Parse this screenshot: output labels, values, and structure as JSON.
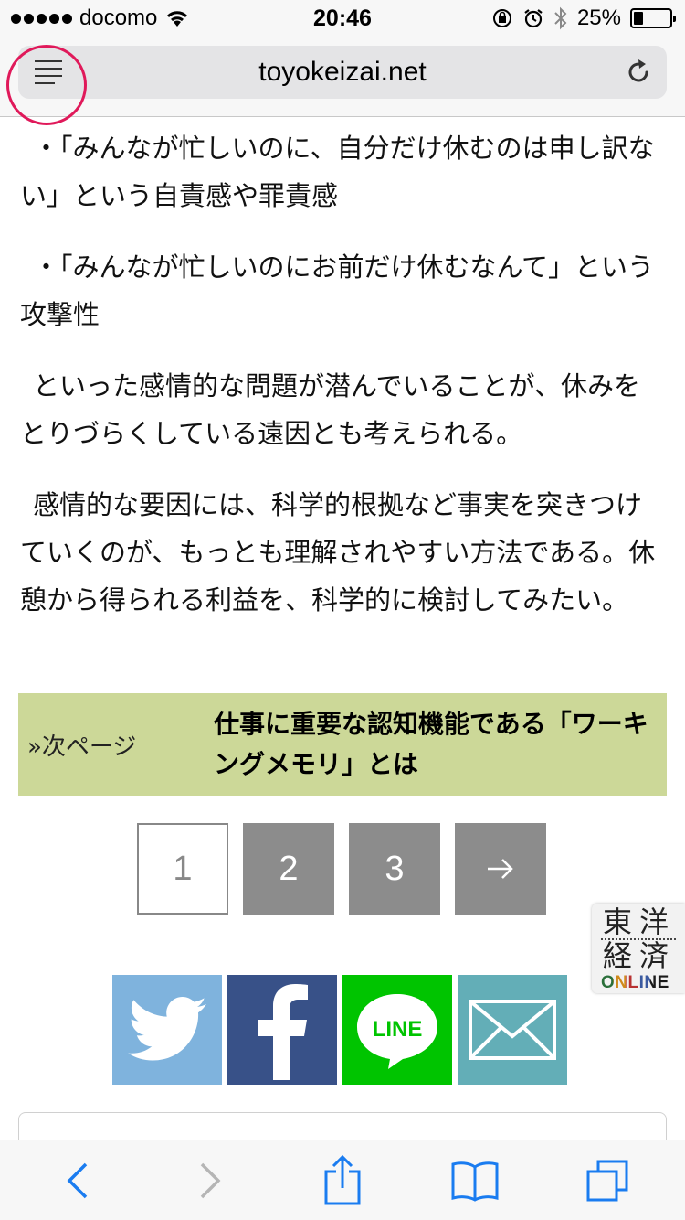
{
  "status_bar": {
    "carrier": "docomo",
    "time": "20:46",
    "battery_percent_text": "25%",
    "battery_level": 0.25
  },
  "browser": {
    "url": "toyokeizai.net"
  },
  "article": {
    "paragraphs": [
      "・「みんなが忙しいのに、自分だけ休むのは申し訳ない」という自責感や罪責感",
      "・「みんなが忙しいのにお前だけ休むなんて」という攻撃性",
      "といった感情的な問題が潜んでいることが、休みをとりづらくしている遠因とも考えられる。",
      "感情的な要因には、科学的根拠など事実を突きつけていくのが、もっとも理解されやすい方法である。休憩から得られる利益を、科学的に検討してみたい。"
    ]
  },
  "next_page": {
    "label": "»次ページ",
    "title": "仕事に重要な認知機能である「ワーキングメモリ」とは"
  },
  "pagination": {
    "pages": [
      "1",
      "2",
      "3"
    ],
    "current": "1",
    "next_arrow": "→"
  },
  "share": {
    "line_label": "LINE",
    "facebook_glyph": "f"
  },
  "logo": {
    "line1": "東洋",
    "line2": "経済",
    "online": "ONLINE"
  },
  "colors": {
    "banner_bg": "#ccd898",
    "twitter": "#7fb3dd",
    "facebook": "#385188",
    "line": "#00c400",
    "mail": "#63aeb7",
    "ios_blue": "#1a7cf0",
    "highlight_ring": "#e0195a"
  }
}
